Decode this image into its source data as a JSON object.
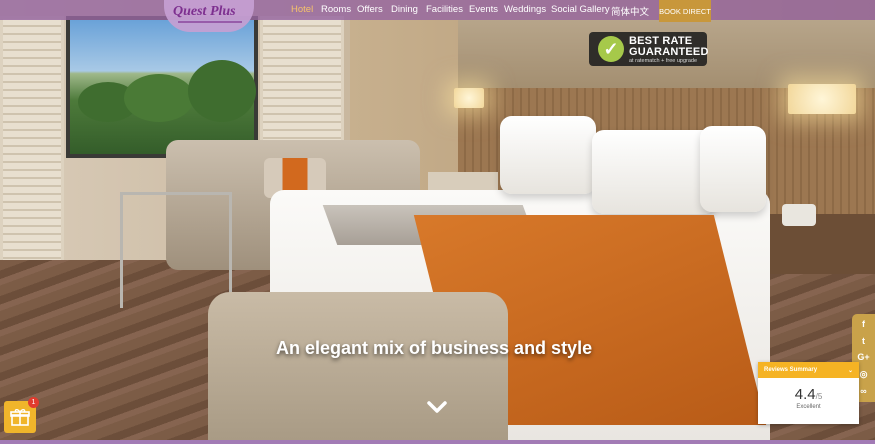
{
  "brand": {
    "logo_text": "Quest Plus"
  },
  "nav": {
    "items": [
      {
        "label": "Hotel",
        "active": true
      },
      {
        "label": "Rooms",
        "active": false
      },
      {
        "label": "Offers",
        "active": false
      },
      {
        "label": "Dining",
        "active": false
      },
      {
        "label": "Facilities",
        "active": false
      },
      {
        "label": "Events",
        "active": false
      },
      {
        "label": "Weddings",
        "active": false
      },
      {
        "label": "Social Gallery",
        "active": false
      },
      {
        "label": "简体中文",
        "active": false
      }
    ],
    "book_label": "BOOK DIRECT"
  },
  "badge": {
    "line1": "BEST RATE",
    "line2": "GUARANTEED",
    "line3": "at ratematch + free upgrade"
  },
  "hero": {
    "tagline": "An elegant mix of business and style"
  },
  "social": {
    "icons": [
      "facebook-icon",
      "twitter-icon",
      "google-plus-icon",
      "instagram-icon",
      "tripadvisor-icon"
    ],
    "glyphs": [
      "f",
      "t",
      "G+",
      "◎",
      "∞"
    ]
  },
  "reviews": {
    "title": "Reviews Summary",
    "score": "4.4",
    "out_of": "/5",
    "label": "Excellent"
  },
  "gift": {
    "count": "1"
  },
  "colors": {
    "nav_bg": "#9666a0",
    "accent_gold": "#c8973b",
    "active_nav": "#f5c26b",
    "reviews_header": "#f5b324",
    "badge_check": "#a6c94a",
    "notification": "#e03c2e"
  }
}
